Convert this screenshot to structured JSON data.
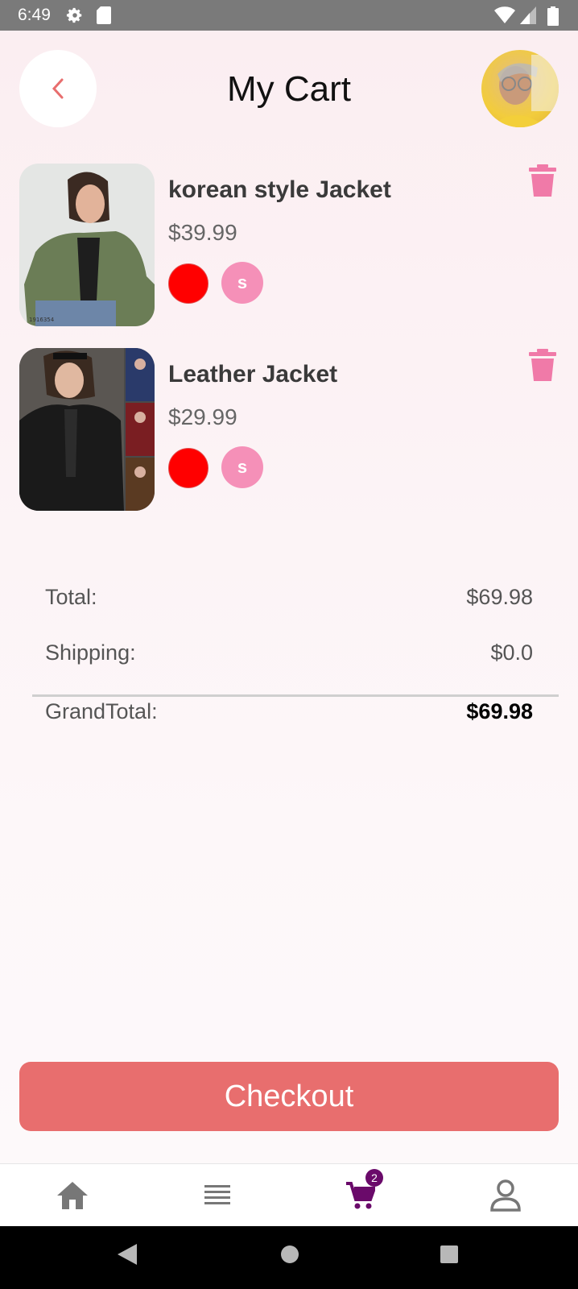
{
  "status_bar": {
    "time": "6:49",
    "icons": [
      "settings-icon",
      "sd-card-icon",
      "wifi-icon",
      "signal-icon",
      "battery-icon"
    ]
  },
  "header": {
    "title": "My Cart",
    "back_icon": "chevron-left-icon"
  },
  "colors": {
    "accent": "#e86e6e",
    "size_chip": "#f590b8",
    "swatch_red": "#ff0000",
    "trash": "#f07aa8",
    "active_nav": "#6a0a6a"
  },
  "cart_items": [
    {
      "name": " korean style Jacket",
      "price": "$39.99",
      "size": "s",
      "color": "#ff0000"
    },
    {
      "name": "Leather Jacket",
      "price": "$29.99",
      "size": "s",
      "color": "#ff0000"
    }
  ],
  "summary": {
    "total_label": "Total:",
    "total_value": "$69.98",
    "shipping_label": "Shipping:",
    "shipping_value": "$0.0",
    "grand_label": "GrandTotal:",
    "grand_value": "$69.98"
  },
  "checkout": {
    "label": "Checkout"
  },
  "bottom_nav": {
    "items": [
      "home-icon",
      "list-icon",
      "cart-icon",
      "profile-icon"
    ],
    "cart_badge": "2",
    "active": "cart"
  },
  "system_nav": [
    "back-icon",
    "home-icon",
    "recents-icon"
  ]
}
